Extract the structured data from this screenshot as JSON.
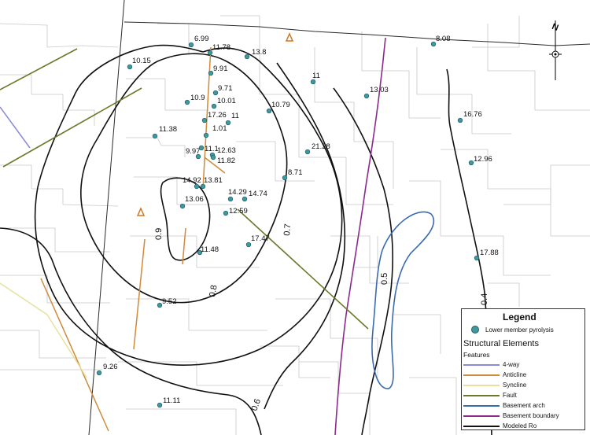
{
  "map": {
    "points": [
      {
        "label": "6.99"
      },
      {
        "label": "11.78"
      },
      {
        "label": "13.8"
      },
      {
        "label": "8.08"
      },
      {
        "label": "10.15"
      },
      {
        "label": "9.91"
      },
      {
        "label": "11"
      },
      {
        "label": "13.03"
      },
      {
        "label": "9.71"
      },
      {
        "label": "10.9"
      },
      {
        "label": "10.01"
      },
      {
        "label": "10.79"
      },
      {
        "label": "17.26"
      },
      {
        "label": "11"
      },
      {
        "label": "16.76"
      },
      {
        "label": "11.38"
      },
      {
        "label": "1.01"
      },
      {
        "label": "21.28"
      },
      {
        "label": "9.97"
      },
      {
        "label": "11.1"
      },
      {
        "label": "12.63"
      },
      {
        "label": "11.82"
      },
      {
        "label": "12.96"
      },
      {
        "label": "8.71"
      },
      {
        "label": "14.92"
      },
      {
        "label": "13.81"
      },
      {
        "label": "14.29"
      },
      {
        "label": "14.74"
      },
      {
        "label": "13.06"
      },
      {
        "label": "12.59"
      },
      {
        "label": "17.47"
      },
      {
        "label": "11.48"
      },
      {
        "label": "17.88"
      },
      {
        "label": "9.52"
      },
      {
        "label": "9.26"
      },
      {
        "label": "11.11"
      }
    ],
    "contour_labels": [
      "0.9",
      "0.8",
      "0.7",
      "0.6",
      "0.5",
      "0.4"
    ],
    "north_label": "N"
  },
  "legend": {
    "title": "Legend",
    "point_label": "Lower member pyrolysis",
    "structural_title": "Structural Elements",
    "features_title": "Features",
    "items": [
      {
        "label": "4-way",
        "color": "#8a8ad8"
      },
      {
        "label": "Anticline",
        "color": "#d08a3c"
      },
      {
        "label": "Syncline",
        "color": "#e8e0a0"
      },
      {
        "label": "Fault",
        "color": "#6b7a2a"
      },
      {
        "label": "Basement arch",
        "color": "#3a6ab0"
      },
      {
        "label": "Basement boundary",
        "color": "#8a2a8a"
      },
      {
        "label": "Modeled Ro",
        "color": "#111111"
      }
    ]
  },
  "colors": {
    "point_fill": "#3f9aa0",
    "anticline_triangle": "#d0781e"
  }
}
